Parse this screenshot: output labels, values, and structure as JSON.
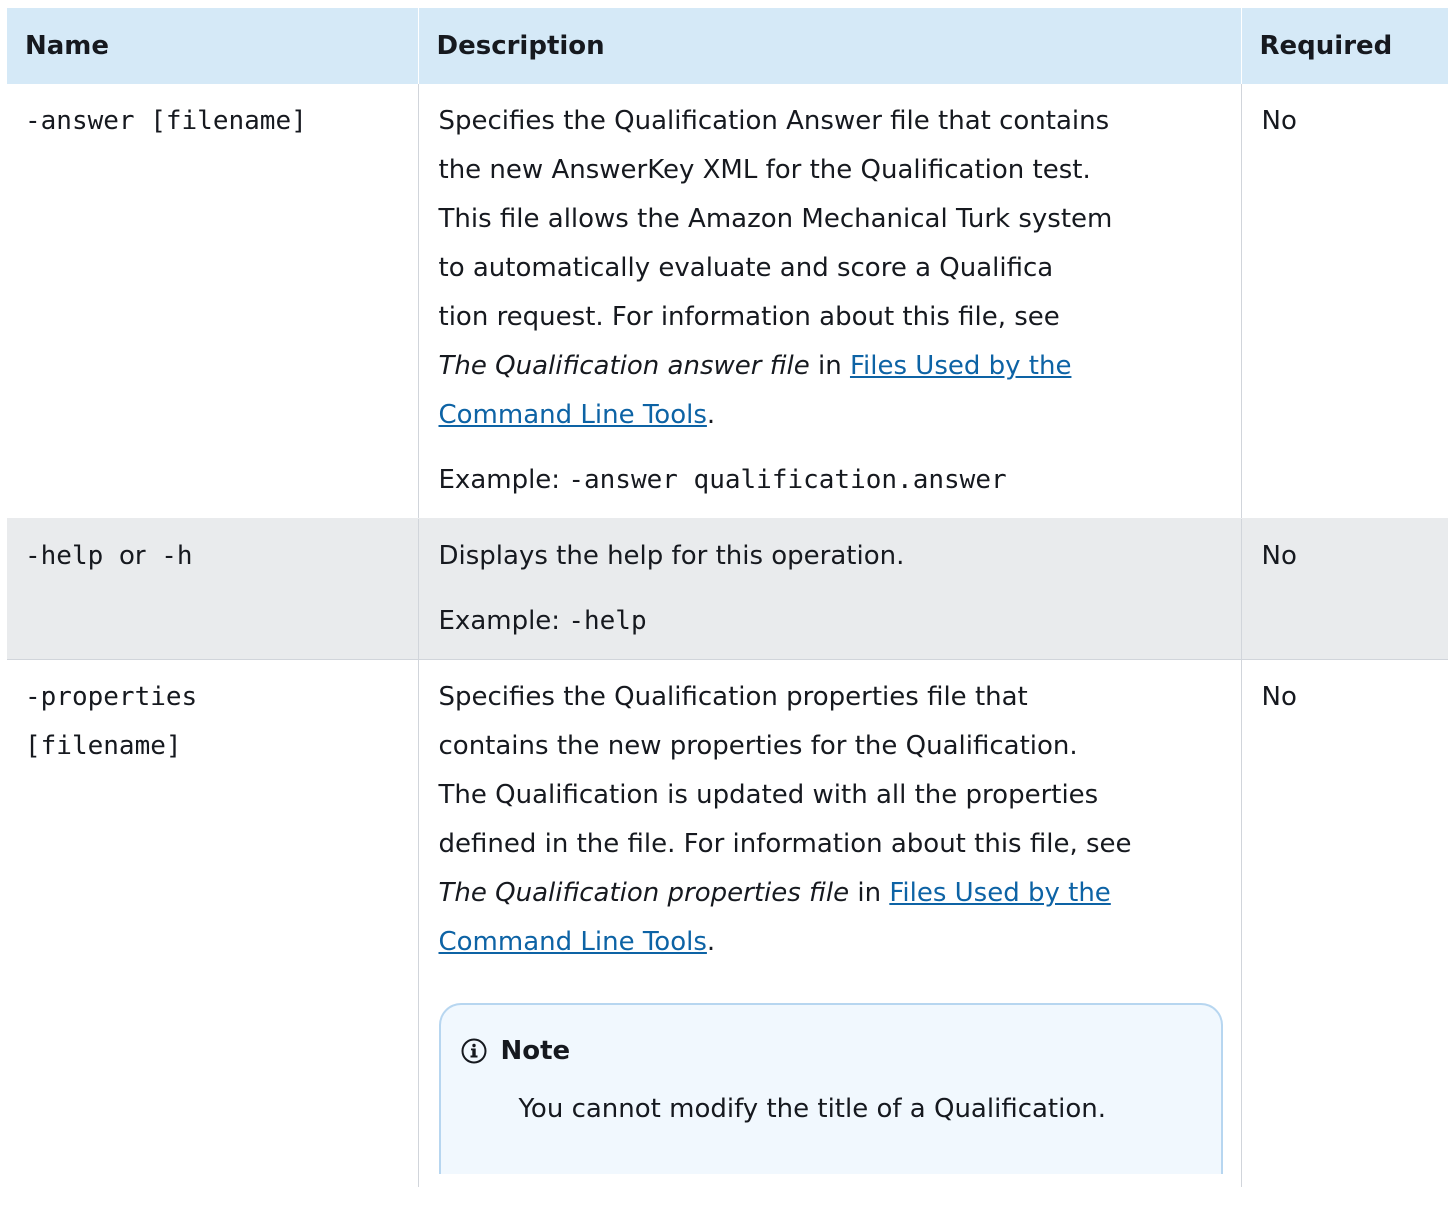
{
  "table": {
    "headers": {
      "name": "Name",
      "description": "Description",
      "required": "Required"
    },
    "rows": [
      {
        "name": "-answer [filename]",
        "description_lines": [
          "Specifies the Qualification Answer file that contains",
          "the new AnswerKey XML for the Qualification test.",
          "This file allows the Amazon Mechanical Turk system",
          "to automatically evaluate and score a Qualifica",
          "tion request. For information about this file, see"
        ],
        "ref_italic": "The Qualification answer file",
        "ref_in": "in",
        "link_line1": "Files Used by the",
        "link_line2": "Command Line Tools",
        "period": ".",
        "example_label": "Example:",
        "example_code": "-answer qualification.answer",
        "required": "No"
      },
      {
        "name_part1": "-help",
        "name_or": "or",
        "name_part2": "-h",
        "description": "Displays the help for this operation.",
        "example_label": "Example:",
        "example_code": "-help",
        "required": "No"
      },
      {
        "name_line1": "-properties",
        "name_line2": "[filename]",
        "description_lines": [
          "Specifies the Qualification properties file that",
          "contains the new properties for the Qualification.",
          "The Qualification is updated with all the properties",
          "defined in the file. For information about this file, see"
        ],
        "ref_italic": "The Qualification properties file",
        "ref_in": "in",
        "link_line1": "Files Used by the",
        "link_line2": "Command Line Tools",
        "period": ".",
        "note": {
          "icon": "info-circle-icon",
          "title": "Note",
          "body": "You cannot modify the title of a Qualification."
        },
        "required": "No"
      }
    ]
  },
  "colors": {
    "header_bg": "#d5e9f7",
    "alt_row_bg": "#e9ebed",
    "link": "#0d63a5",
    "note_bg": "#f1f8fe",
    "note_border": "#b7d6f0"
  }
}
